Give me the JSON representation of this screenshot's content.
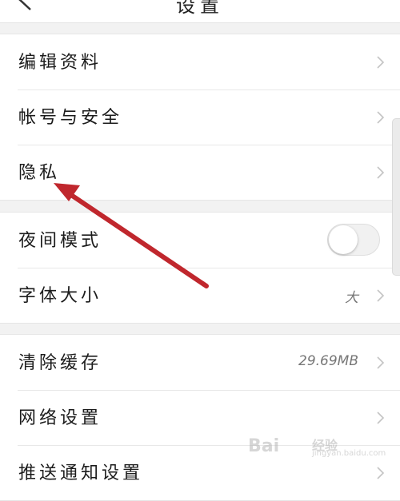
{
  "header": {
    "title": "设置",
    "back_icon": "chevron-left-icon"
  },
  "groups": [
    {
      "items": [
        {
          "label": "编辑资料",
          "value": ""
        },
        {
          "label": "帐号与安全",
          "value": ""
        },
        {
          "label": "隐私",
          "value": ""
        }
      ]
    },
    {
      "items": [
        {
          "label": "夜间模式",
          "toggle": false
        },
        {
          "label": "字体大小",
          "value": "大"
        }
      ]
    },
    {
      "items": [
        {
          "label": "清除缓存",
          "value": "29.69MB"
        },
        {
          "label": "网络设置",
          "value": ""
        },
        {
          "label": "推送通知设置",
          "value": ""
        }
      ]
    }
  ],
  "annotation": {
    "type": "arrow",
    "color": "#c0272d",
    "target": "隐私"
  },
  "watermark": {
    "text": "Bai",
    "sub": "经验",
    "domain": "jingyan.baidu.com"
  }
}
